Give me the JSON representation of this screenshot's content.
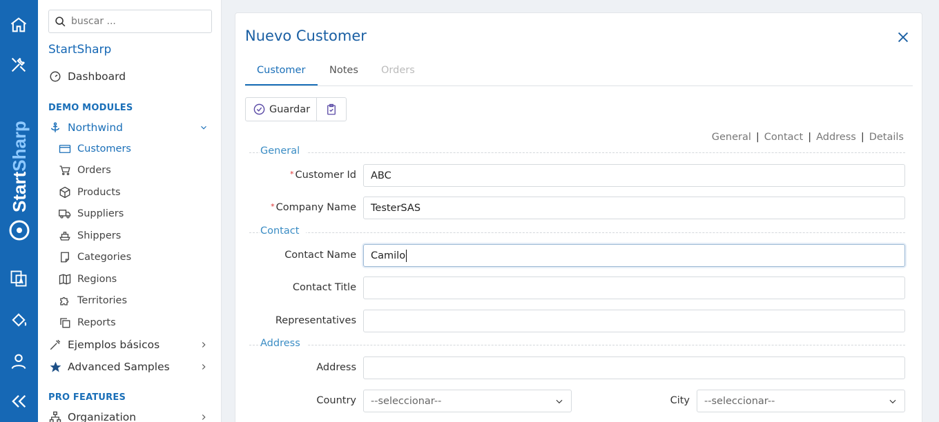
{
  "sidebar": {
    "search_placeholder": "buscar ...",
    "brand": "StartSharp",
    "dashboard": "Dashboard",
    "demo_section": "DEMO MODULES",
    "northwind": "Northwind",
    "items": [
      {
        "label": "Customers",
        "icon": "card-icon",
        "active": true
      },
      {
        "label": "Orders",
        "icon": "cart-icon"
      },
      {
        "label": "Products",
        "icon": "box-icon"
      },
      {
        "label": "Suppliers",
        "icon": "truck-icon"
      },
      {
        "label": "Shippers",
        "icon": "ship-icon"
      },
      {
        "label": "Categories",
        "icon": "note-icon"
      },
      {
        "label": "Regions",
        "icon": "map-icon"
      },
      {
        "label": "Territories",
        "icon": "puzzle-icon"
      },
      {
        "label": "Reports",
        "icon": "copy-icon"
      }
    ],
    "basic_samples": "Ejemplos básicos",
    "advanced_samples": "Advanced Samples",
    "pro_section": "PRO FEATURES",
    "organization": "Organization"
  },
  "rail": {
    "brand_vertical": "StartSharp"
  },
  "dialog": {
    "title": "Nuevo Customer",
    "tabs": [
      "Customer",
      "Notes",
      "Orders"
    ],
    "save_label": "Guardar",
    "category_links": [
      "General",
      "Contact",
      "Address",
      "Details"
    ],
    "categories": {
      "general": "General",
      "contact": "Contact",
      "address": "Address"
    },
    "fields": {
      "customer_id": {
        "label": "Customer Id",
        "value": "ABC",
        "required": true
      },
      "company_name": {
        "label": "Company Name",
        "value": "TesterSAS",
        "required": true
      },
      "contact_name": {
        "label": "Contact Name",
        "value": "Camilo"
      },
      "contact_title": {
        "label": "Contact Title",
        "value": ""
      },
      "representatives": {
        "label": "Representatives",
        "value": ""
      },
      "address": {
        "label": "Address",
        "value": ""
      },
      "country": {
        "label": "Country",
        "value": "--seleccionar--"
      },
      "city": {
        "label": "City",
        "value": "--seleccionar--"
      }
    },
    "required_mark": "*"
  },
  "colors": {
    "primary": "#1668b5",
    "accent": "#1a6fb8",
    "category": "#3a8cc4"
  }
}
